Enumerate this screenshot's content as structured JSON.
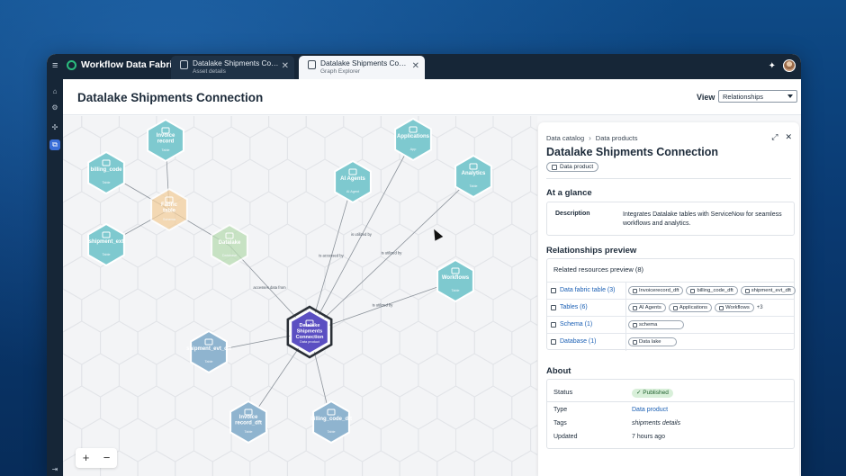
{
  "app": {
    "name": "Workflow Data Fabric",
    "tabs": [
      {
        "title": "Datalake Shipments Connection",
        "subtitle": "Asset details"
      },
      {
        "title": "Datalake Shipments Connection",
        "subtitle": "Graph Explorer"
      }
    ]
  },
  "header": {
    "title": "Datalake Shipments Connection",
    "view_label": "View",
    "view_value": "Relationships"
  },
  "graph": {
    "nodes": {
      "invoice_record": {
        "title": "Invoice record",
        "sub": "Table"
      },
      "billing_code": {
        "title": "billing_code",
        "sub": "Table"
      },
      "shipment_ext": {
        "title": "shipment_ext",
        "sub": "Table"
      },
      "fabric_table": {
        "title": "Fabric table",
        "sub": "Schema"
      },
      "datalake": {
        "title": "Datalake",
        "sub": "Database"
      },
      "ai_agents": {
        "title": "AI Agents",
        "sub": "AI Agent"
      },
      "applications": {
        "title": "Applications",
        "sub": "App"
      },
      "analytics": {
        "title": "Analytics",
        "sub": "Table"
      },
      "workflows": {
        "title": "Workflows",
        "sub": "Table"
      },
      "center": {
        "title": "Datalake Shipments Connection",
        "sub": "Data product"
      },
      "shipment_evt_dft": {
        "title": "shipment_evt_dft",
        "sub": "Table"
      },
      "invoice_record_dft": {
        "title": "Invoice record_dft",
        "sub": "Table"
      },
      "billing_code_dft": {
        "title": "billing_code_dft",
        "sub": "Table"
      }
    },
    "edge_labels": {
      "datalake": "accesses data from",
      "ai_agents": "is accessed by",
      "applications": "is utilized by",
      "analytics": "is utilized by",
      "workflows": "is utilized by"
    },
    "zoom_in": "+",
    "zoom_out": "−"
  },
  "panel": {
    "breadcrumb": [
      "Data catalog",
      "Data products"
    ],
    "title": "Datalake Shipments Connection",
    "type_chip": "Data product",
    "at_a_glance": {
      "title": "At a glance",
      "description_label": "Description",
      "description": "Integrates Datalake tables with ServiceNow for seamless workflows and analytics."
    },
    "relationships": {
      "title": "Relationships preview",
      "subtitle": "Related resources preview (8)",
      "rows": [
        {
          "name": "Data fabric table (3)",
          "chips": [
            "Invoicerecord_dft",
            "billing_code_dft",
            "shipment_evt_dft"
          ],
          "more": ""
        },
        {
          "name": "Tables (6)",
          "chips": [
            "AI Agents",
            "Applications",
            "Workflows"
          ],
          "more": "+3"
        },
        {
          "name": "Schema (1)",
          "chips": [
            "schema"
          ],
          "more": ""
        },
        {
          "name": "Database (1)",
          "chips": [
            "Data lake"
          ],
          "more": ""
        }
      ]
    },
    "about": {
      "title": "About",
      "status_label": "Status",
      "status_value": "Published",
      "type_label": "Type",
      "type_value": "Data product",
      "tags_label": "Tags",
      "tags_value": "shipments details",
      "updated_label": "Updated",
      "updated_value": "7 hours ago"
    }
  },
  "colors": {
    "accent": "#3a6fd8",
    "teal_node": "#7ec9cf",
    "blue_node": "#8fb4cf",
    "center_node": "#5b4fc2",
    "schema_node": "#f3cf9d",
    "database_node": "#b9dcb3",
    "status_green": "#d8efd9"
  },
  "icons": [
    "menu-icon",
    "workflow-logo-icon",
    "table-icon",
    "close-icon",
    "sparkle-icon",
    "home-icon",
    "settings-icon",
    "fan-icon",
    "data-icon",
    "expand-icon",
    "chevron-right-icon",
    "check-icon"
  ]
}
